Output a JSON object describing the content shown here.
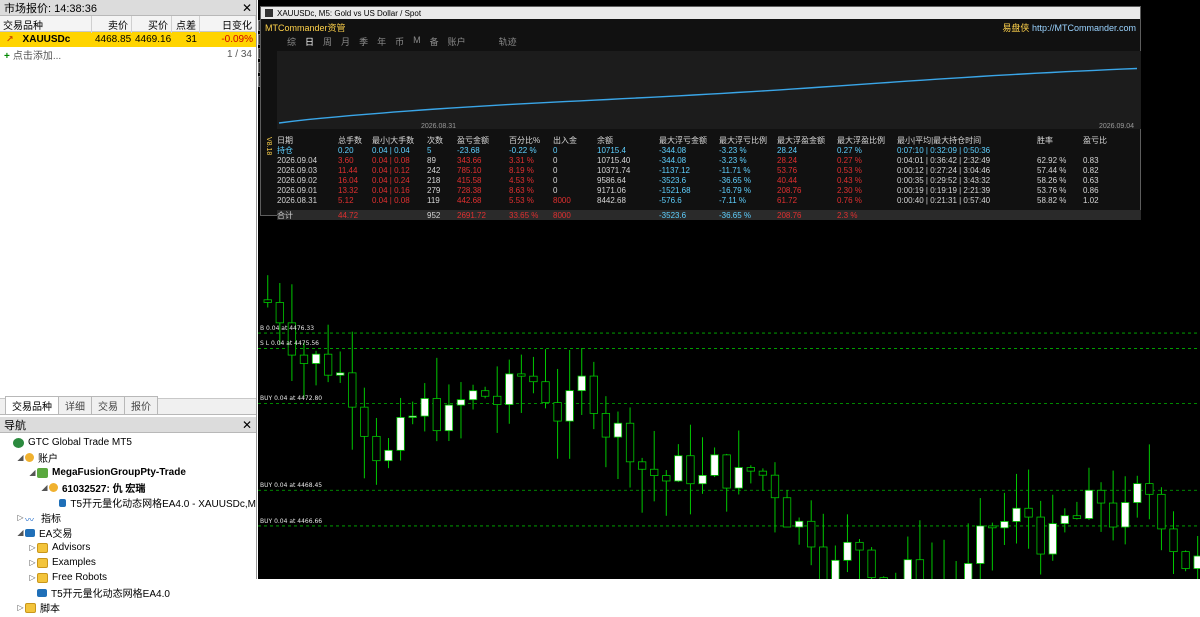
{
  "market_watch": {
    "title": "市场报价: 14:38:36",
    "columns": [
      "交易品种",
      "卖价",
      "买价",
      "点差",
      "日变化"
    ],
    "rows": [
      {
        "symbol": "XAUUSDc",
        "bid": "4468.85",
        "ask": "4469.16",
        "spread": "31",
        "change": "-0.09%"
      }
    ],
    "add_label": "点击添加...",
    "count": "1 / 34",
    "tabs": [
      "交易品种",
      "详细",
      "交易",
      "报价"
    ]
  },
  "navigator": {
    "title": "导航",
    "items": [
      {
        "label": "GTC Global Trade MT5",
        "level": 0,
        "icon": "broker-icon",
        "arrow": ""
      },
      {
        "label": "账户",
        "level": 1,
        "icon": "accounts-icon",
        "arrow": "◢"
      },
      {
        "label": "MegaFusionGroupPty-Trade",
        "level": 2,
        "icon": "server-icon",
        "arrow": "◢",
        "bold": true
      },
      {
        "label": "61032527: 仇 宏瑞",
        "level": 3,
        "icon": "user-icon",
        "arrow": "◢",
        "bold": true
      },
      {
        "label": "T5开元量化动态网格EA4.0 - XAUUSDc,M",
        "level": 4,
        "icon": "expert-icon",
        "arrow": ""
      },
      {
        "label": "指标",
        "level": 1,
        "icon": "indicators-icon",
        "arrow": "▷"
      },
      {
        "label": "EA交易",
        "level": 1,
        "icon": "experts-icon",
        "arrow": "◢"
      },
      {
        "label": "Advisors",
        "level": 2,
        "icon": "folder-icon",
        "arrow": "▷"
      },
      {
        "label": "Examples",
        "level": 2,
        "icon": "folder-icon",
        "arrow": "▷"
      },
      {
        "label": "Free Robots",
        "level": 2,
        "icon": "folder-icon",
        "arrow": "▷"
      },
      {
        "label": "T5开元量化动态网格EA4.0",
        "level": 2,
        "icon": "expert-icon",
        "arrow": ""
      },
      {
        "label": "脚本",
        "level": 1,
        "icon": "scripts-icon",
        "arrow": "▷"
      }
    ]
  },
  "chart": {
    "window_title": "XAUUSDc, M5: Gold vs US Dollar / Spot",
    "level_labels": [
      {
        "text": "B 0.04 at 4476.33",
        "price": 4476.33
      },
      {
        "text": "S L 0.04 at 4475.56",
        "price": 4475.56
      },
      {
        "text": "BUY 0.04 at 4472.80",
        "price": 4472.8
      },
      {
        "text": "BUY 0.04 at 4468.45",
        "price": 4468.45
      },
      {
        "text": "BUY 0.04 at 4466.66",
        "price": 4466.66
      }
    ]
  },
  "overlay": {
    "brand": "MTCommander资管",
    "brand_right": "易盘侠",
    "brand_url": "http://MTCommander.com",
    "tabs": [
      "综",
      "日",
      "周",
      "月",
      "季",
      "年",
      "币",
      "M",
      "备",
      "账户",
      "轨迹"
    ],
    "active_tab": "日",
    "vertical_text": "V8.18",
    "equity_date_start": "2026.08.31",
    "equity_date_end": "2026.09.04",
    "columns": [
      "日期",
      "总手数",
      "最小|大手数",
      "次数",
      "盈亏金额",
      "百分比%",
      "出入金",
      "余额",
      "最大浮亏金额",
      "最大浮亏比例",
      "最大浮盈金额",
      "最大浮盈比例",
      "最小|平均|最大持仓时间",
      "胜率",
      "盈亏比"
    ],
    "holding": {
      "date": "持仓",
      "lots": "0.20",
      "minmax": "0.04 | 0.04",
      "count": "5",
      "pnl": "-23.68",
      "pct": "-0.22 %",
      "io": "0",
      "balance": "10715.4",
      "maxfl": "-344.08",
      "maxflp": "-3.23 %",
      "maxfp": "28.24",
      "maxfpp": "0.27 %",
      "time": "0:07:10 | 0:32:09 | 0:50:36",
      "win": "",
      "ratio": ""
    },
    "rows": [
      {
        "date": "2026.09.04",
        "lots": "3.60",
        "minmax": "0.04 | 0.08",
        "count": "89",
        "pnl": "343.66",
        "pct": "3.31 %",
        "io": "0",
        "balance": "10715.40",
        "maxfl": "-344.08",
        "maxflp": "-3.23 %",
        "maxfp": "28.24",
        "maxfpp": "0.27 %",
        "time": "0:04:01 | 0:36:42 | 2:32:49",
        "win": "62.92 %",
        "ratio": "0.83"
      },
      {
        "date": "2026.09.03",
        "lots": "11.44",
        "minmax": "0.04 | 0.12",
        "count": "242",
        "pnl": "785.10",
        "pct": "8.19 %",
        "io": "0",
        "balance": "10371.74",
        "maxfl": "-1137.12",
        "maxflp": "-11.71 %",
        "maxfp": "53.76",
        "maxfpp": "0.53 %",
        "time": "0:00:12 | 0:27:24 | 3:04:46",
        "win": "57.44 %",
        "ratio": "0.82"
      },
      {
        "date": "2026.09.02",
        "lots": "16.04",
        "minmax": "0.04 | 0.24",
        "count": "218",
        "pnl": "415.58",
        "pct": "4.53 %",
        "io": "0",
        "balance": "9586.64",
        "maxfl": "-3523.6",
        "maxflp": "-36.65 %",
        "maxfp": "40.44",
        "maxfpp": "0.43 %",
        "time": "0:00:35 | 0:29:52 | 3:43:32",
        "win": "58.26 %",
        "ratio": "0.63"
      },
      {
        "date": "2026.09.01",
        "lots": "13.32",
        "minmax": "0.04 | 0.16",
        "count": "279",
        "pnl": "728.38",
        "pct": "8.63 %",
        "io": "0",
        "balance": "9171.06",
        "maxfl": "-1521.68",
        "maxflp": "-16.79 %",
        "maxfp": "208.76",
        "maxfpp": "2.30 %",
        "time": "0:00:19 | 0:19:19 | 2:21:39",
        "win": "53.76 %",
        "ratio": "0.86"
      },
      {
        "date": "2026.08.31",
        "lots": "5.12",
        "minmax": "0.04 | 0.08",
        "count": "119",
        "pnl": "442.68",
        "pct": "5.53 %",
        "io": "8000",
        "balance": "8442.68",
        "maxfl": "-576.6",
        "maxflp": "-7.11 %",
        "maxfp": "61.72",
        "maxfpp": "0.76 %",
        "time": "0:00:40 | 0:21:31 | 0:57:40",
        "win": "58.82 %",
        "ratio": "1.02"
      }
    ],
    "total": {
      "date": "合计",
      "lots": "44.72",
      "minmax": "",
      "count": "952",
      "pnl": "2691.72",
      "pct": "33.65 %",
      "io": "8000",
      "balance": "",
      "maxfl": "-3523.6",
      "maxflp": "-36.65 %",
      "maxfp": "208.76",
      "maxfpp": "2.3 %",
      "time": "",
      "win": "",
      "ratio": ""
    }
  },
  "colors": {
    "bull_candle": "#ffffff",
    "bear_candle": "#000000",
    "wick": "#00c800",
    "level_line": "#00b400",
    "highlight_row": "#ffd400",
    "negative": "#e03030",
    "cyan": "#5fd0ff"
  }
}
